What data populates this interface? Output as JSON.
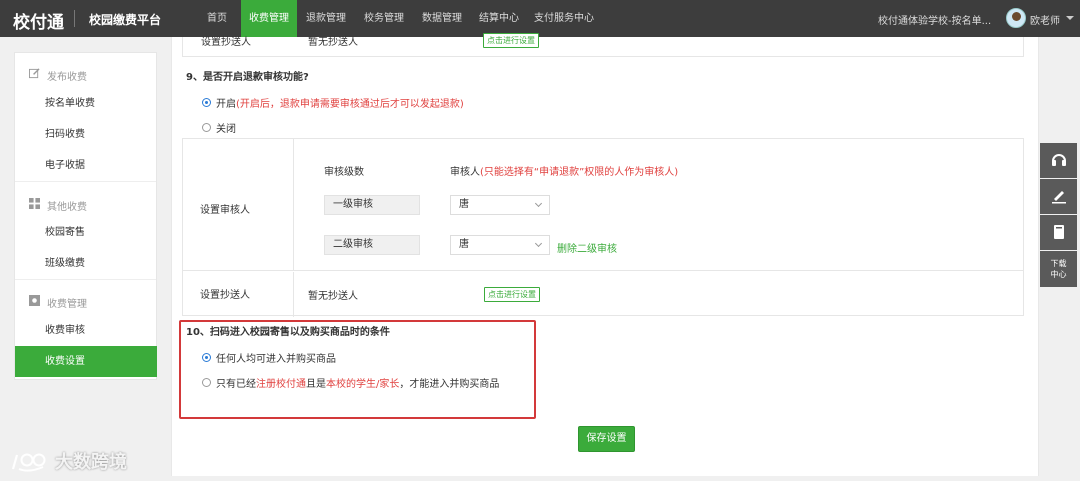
{
  "header": {
    "logo": "校付通",
    "platform": "校园缴费平台",
    "nav": [
      {
        "label": "首页",
        "active": false
      },
      {
        "label": "收费管理",
        "active": true
      },
      {
        "label": "退款管理",
        "active": false
      },
      {
        "label": "校务管理",
        "active": false
      },
      {
        "label": "数据管理",
        "active": false
      },
      {
        "label": "结算中心",
        "active": false
      },
      {
        "label": "支付服务中心",
        "active": false
      }
    ],
    "school": "校付通体验学校-按名单...",
    "username": "欧老师"
  },
  "sidebar": {
    "groups": [
      {
        "label": "发布收费",
        "icon": "edit-icon",
        "items": [
          "按名单收费",
          "扫码收费",
          "电子收据"
        ]
      },
      {
        "label": "其他收费",
        "icon": "grid-icon",
        "items": [
          "校园寄售",
          "班级缴费"
        ]
      },
      {
        "label": "收费管理",
        "icon": "gear-icon",
        "items": [
          "收费审核",
          "收费设置"
        ]
      }
    ],
    "active_item": "收费设置"
  },
  "settings": {
    "cc_top": {
      "label": "设置抄送人",
      "value": "暂无抄送人",
      "button": "点击进行设置"
    },
    "q9": {
      "title": "9、是否开启退款审核功能?",
      "open_label": "开启",
      "open_note": "(开启后，退款申请需要审核通过后才可以发起退款)",
      "close_label": "关闭",
      "selected": "open"
    },
    "auditors": {
      "row_label": "设置审核人",
      "level_header": "审核级数",
      "auditor_header_prefix": "审核人",
      "auditor_header_note": "(只能选择有“申请退款”权限的人作为审核人)",
      "levels": [
        {
          "level": "一级审核",
          "auditor": "唐"
        },
        {
          "level": "二级审核",
          "auditor": "唐"
        }
      ],
      "delete_link": "删除二级审核",
      "cc_label": "设置抄送人",
      "cc_value": "暂无抄送人",
      "cc_button": "点击进行设置"
    },
    "q10": {
      "title": "10、扫码进入校园寄售以及购买商品时的条件",
      "option1": "任何人均可进入并购买商品",
      "option2_prefix": "只有已经",
      "option2_red1": "注册校付通",
      "option2_mid": "且是",
      "option2_red2": "本校的学生/家长",
      "option2_suffix": "，才能进入并购买商品",
      "selected": "option1"
    },
    "save_button": "保存设置"
  },
  "side_tools": {
    "download_label": "下载中心",
    "icons": [
      "headset-icon",
      "pen-icon",
      "book-icon"
    ]
  },
  "watermark": {
    "text": "大数跨境"
  },
  "colors": {
    "accent": "#3bab3b",
    "nav_bg": "#3d3d3d",
    "highlight_border": "#d3393a",
    "note_red": "#e0413f"
  }
}
